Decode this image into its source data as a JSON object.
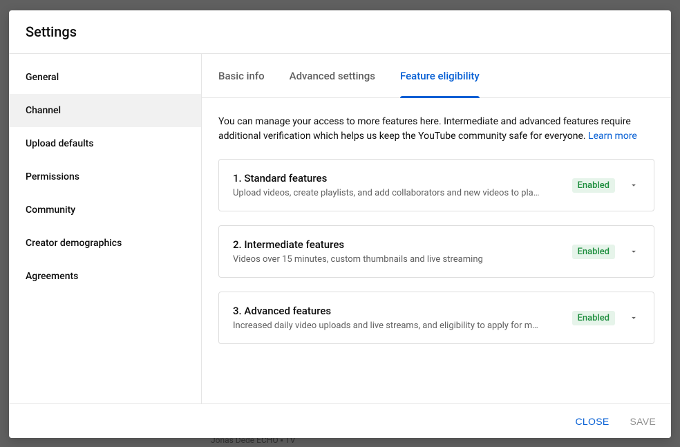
{
  "header": {
    "title": "Settings"
  },
  "sidebar": {
    "items": [
      {
        "label": "General",
        "active": false
      },
      {
        "label": "Channel",
        "active": true
      },
      {
        "label": "Upload defaults",
        "active": false
      },
      {
        "label": "Permissions",
        "active": false
      },
      {
        "label": "Community",
        "active": false
      },
      {
        "label": "Creator demographics",
        "active": false
      },
      {
        "label": "Agreements",
        "active": false
      }
    ]
  },
  "tabs": [
    {
      "label": "Basic info",
      "active": false
    },
    {
      "label": "Advanced settings",
      "active": false
    },
    {
      "label": "Feature eligibility",
      "active": true
    }
  ],
  "intro": {
    "text": "You can manage your access to more features here. Intermediate and advanced features require additional verification which helps us keep the YouTube community safe for everyone. ",
    "link": "Learn more"
  },
  "features": [
    {
      "title": "1. Standard features",
      "desc": "Upload videos, create playlists, and add collaborators and new videos to pla…",
      "status": "Enabled"
    },
    {
      "title": "2. Intermediate features",
      "desc": "Videos over 15 minutes, custom thumbnails and live streaming",
      "status": "Enabled"
    },
    {
      "title": "3. Advanced features",
      "desc": "Increased daily video uploads and live streams, and eligibility to apply for m…",
      "status": "Enabled"
    }
  ],
  "footer": {
    "close": "CLOSE",
    "save": "SAVE"
  },
  "background": {
    "bottom_text": "Jonas Dede ECHO ▪ TV"
  }
}
